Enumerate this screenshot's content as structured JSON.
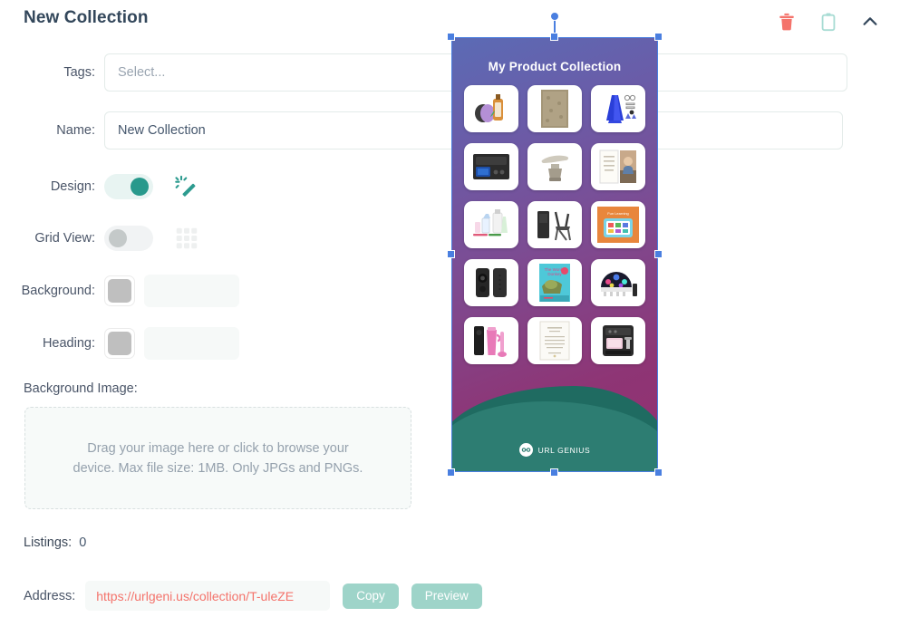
{
  "header": {
    "title": "New Collection",
    "actions": [
      {
        "name": "delete-icon",
        "label": "Delete",
        "color": "#f4736b"
      },
      {
        "name": "clipboard-icon",
        "label": "Duplicate",
        "color": "#a8dcd4"
      },
      {
        "name": "chevron-up-icon",
        "label": "Collapse",
        "color": "#33475b"
      }
    ]
  },
  "form": {
    "tags": {
      "label": "Tags:",
      "value": "",
      "placeholder": "Select..."
    },
    "name": {
      "label": "Name:",
      "value": "New Collection",
      "placeholder": ""
    },
    "design": {
      "label": "Design:",
      "state": "on",
      "icon": "magic-wand-icon"
    },
    "grid_view": {
      "label": "Grid View:",
      "state": "off",
      "icon": "grid-icon"
    },
    "background": {
      "label": "Background:",
      "swatch": "#bfbfbf",
      "value": ""
    },
    "heading": {
      "label": "Heading:",
      "swatch": "#bfbfbf",
      "value": ""
    },
    "background_image": {
      "label": "Background Image:",
      "dropzone_line1": "Drag your image here or click to browse your",
      "dropzone_line2": "device. Max file size: 1MB. Only JPGs and PNGs."
    },
    "listings": {
      "label": "Listings:",
      "value": "0"
    },
    "address": {
      "label": "Address:",
      "url": "https://urlgeni.us/collection/T-uleZE",
      "copy_label": "Copy",
      "preview_label": "Preview"
    }
  },
  "preview": {
    "title": "My Product Collection",
    "footer_brand": "URL GENIUS",
    "colors": {
      "gradient_top": "#5b6bb5",
      "gradient_mid": "#7d4b92",
      "gradient_bottom": "#93306f",
      "wave_back": "#1f6b61",
      "wave_front": "#2d7d72",
      "selection": "#4a7fe0"
    },
    "tiles": [
      {
        "name": "tile-essential-oils"
      },
      {
        "name": "tile-area-rug"
      },
      {
        "name": "tile-blue-dress-form"
      },
      {
        "name": "tile-car-audio-unit"
      },
      {
        "name": "tile-handheld-steamer"
      },
      {
        "name": "tile-wall-art-print"
      },
      {
        "name": "tile-cleaning-supplies"
      },
      {
        "name": "tile-folding-chair"
      },
      {
        "name": "tile-kids-tablet"
      },
      {
        "name": "tile-bluetooth-speakers"
      },
      {
        "name": "tile-childrens-book"
      },
      {
        "name": "tile-disco-ball-light"
      },
      {
        "name": "tile-pink-tumbler-set"
      },
      {
        "name": "tile-menu-card"
      },
      {
        "name": "tile-espresso-machine"
      }
    ]
  }
}
